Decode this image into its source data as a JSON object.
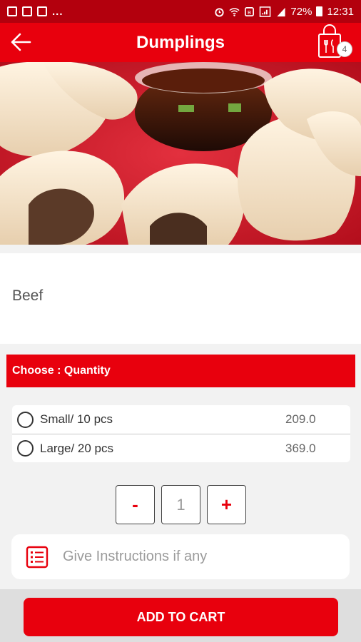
{
  "status_bar": {
    "left_icons": [
      "share-icon",
      "image-icon",
      "map-icon"
    ],
    "overflow": "...",
    "battery_percent": "72%",
    "time": "12:31"
  },
  "app_bar": {
    "title": "Dumplings",
    "cart_count": "4"
  },
  "item": {
    "description": "Beef"
  },
  "choose": {
    "header": "Choose : Quantity",
    "options": [
      {
        "label": "Small/ 10 pcs",
        "price": "209.0"
      },
      {
        "label": "Large/ 20 pcs",
        "price": "369.0"
      }
    ]
  },
  "stepper": {
    "minus": "-",
    "value": "1",
    "plus": "+"
  },
  "instructions": {
    "placeholder": "Give Instructions if any"
  },
  "footer": {
    "add_to_cart": "ADD TO CART"
  },
  "colors": {
    "primary": "#e8000d",
    "status_bar": "#b3000d"
  }
}
